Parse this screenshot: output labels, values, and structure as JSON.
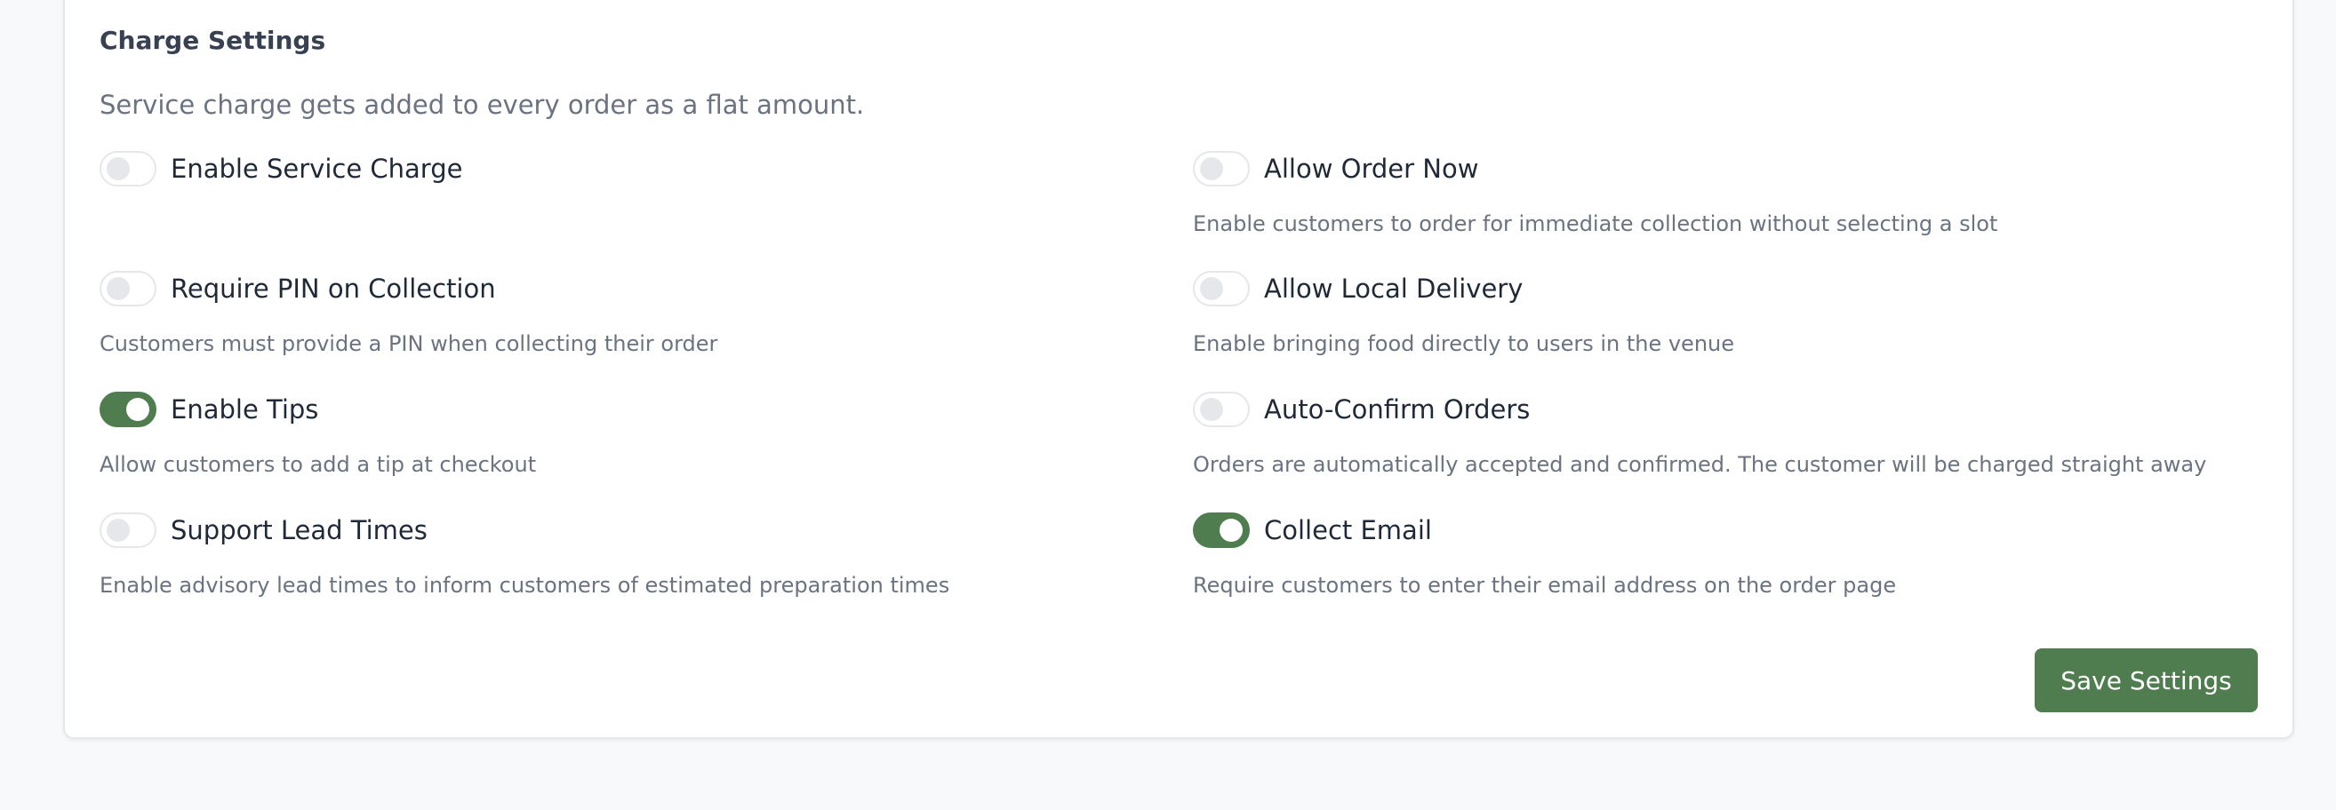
{
  "charge_settings": {
    "title": "Charge Settings",
    "intro": "Service charge gets added to every order as a flat amount.",
    "settings": [
      {
        "label": "Enable Service Charge",
        "enabled": false,
        "description": ""
      },
      {
        "label": "Allow Order Now",
        "enabled": false,
        "description": "Enable customers to order for immediate collection without selecting a slot"
      },
      {
        "label": "Require PIN on Collection",
        "enabled": false,
        "description": "Customers must provide a PIN when collecting their order"
      },
      {
        "label": "Allow Local Delivery",
        "enabled": false,
        "description": "Enable bringing food directly to users in the venue"
      },
      {
        "label": "Enable Tips",
        "enabled": true,
        "description": "Allow customers to add a tip at checkout"
      },
      {
        "label": "Auto-Confirm Orders",
        "enabled": false,
        "description": "Orders are automatically accepted and confirmed. The customer will be charged straight away"
      },
      {
        "label": "Support Lead Times",
        "enabled": false,
        "description": "Enable advisory lead times to inform customers of estimated preparation times"
      },
      {
        "label": "Collect Email",
        "enabled": true,
        "description": "Require customers to enter their email address on the order page"
      }
    ],
    "save_label": "Save Settings"
  },
  "colors": {
    "accent": "#4f7d4f",
    "background": "#f8f9fb",
    "card": "#ffffff",
    "muted_text": "#6b7280"
  }
}
